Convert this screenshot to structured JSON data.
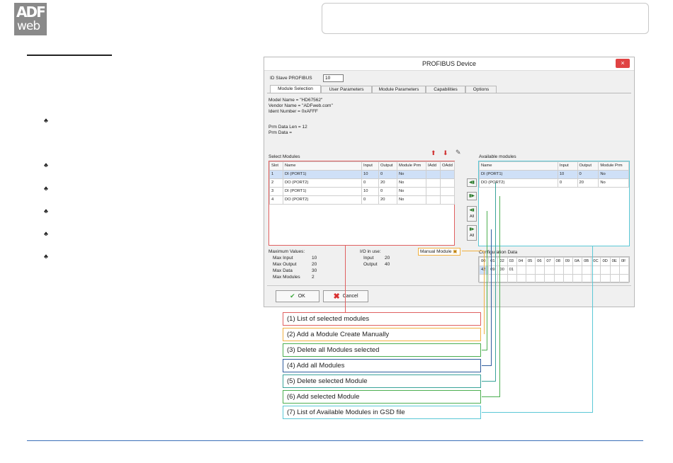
{
  "logo": {
    "line1": "ADF",
    "line2": "web"
  },
  "dialog": {
    "title": "PROFIBUS Device",
    "close": "×",
    "id_slave_label": "ID Slave PROFIBUS",
    "id_slave_value": "10",
    "tabs": [
      "Module Selection",
      "User Parameters",
      "Module Parameters",
      "Capabilities",
      "Options"
    ],
    "info": [
      "Model Name = \"HD67562\"",
      "Vendor Name = \"ADFweb.com\"",
      "Ident Number = 0xAFFF",
      "",
      "Prm Data Len = 12",
      "Prm Data ="
    ],
    "select_label": "Select Modules",
    "available_label": "Available modules",
    "selected_table": {
      "headers": [
        "Slot",
        "Name",
        "Input",
        "Output",
        "Module Prm",
        "IAdd",
        "OAdd"
      ],
      "rows": [
        [
          "1",
          "DI (PORT1)",
          "10",
          "0",
          "No",
          "",
          ""
        ],
        [
          "2",
          "DO (PORT2)",
          "0",
          "20",
          "No",
          "",
          ""
        ],
        [
          "3",
          "DI (PORT1)",
          "10",
          "0",
          "No",
          "",
          ""
        ],
        [
          "4",
          "DO (PORT2)",
          "0",
          "20",
          "No",
          "",
          ""
        ]
      ]
    },
    "available_table": {
      "headers": [
        "Name",
        "Input",
        "Output",
        "Module Prm"
      ],
      "rows": [
        [
          "DI (PORT1)",
          "10",
          "0",
          "No"
        ],
        [
          "DO (PORT2)",
          "0",
          "20",
          "No"
        ]
      ]
    },
    "all_label": "All",
    "manual_module": "Manual Module",
    "config_label": "Configuration Data",
    "config_rows": [
      [
        "00",
        "01",
        "02",
        "03",
        "04",
        "05",
        "06",
        "07",
        "08",
        "09",
        "0A",
        "0B",
        "0C",
        "0D",
        "0E",
        "0F"
      ],
      [
        "42",
        "09",
        "00",
        "01",
        "",
        "",
        "",
        "",
        "",
        "",
        "",
        "",
        "",
        "",
        "",
        ""
      ],
      [
        "",
        "",
        "",
        "",
        "",
        "",
        "",
        "",
        "",
        "",
        "",
        "",
        "",
        "",
        "",
        ""
      ]
    ],
    "max_title": "Maximum Values:",
    "max": [
      [
        "Max Input",
        "10"
      ],
      [
        "Max Output",
        "20"
      ],
      [
        "Max Data",
        "30"
      ],
      [
        "Max Modules",
        "2"
      ]
    ],
    "io_title": "I/O in use:",
    "io": [
      [
        "Input",
        "20"
      ],
      [
        "Output",
        "40"
      ]
    ],
    "ok": "OK",
    "cancel": "Cancel"
  },
  "legend": [
    "(1) List of selected modules",
    "(2) Add a Module Create Manually",
    "(3) Delete all Modules selected",
    "(4) Add all Modules",
    "(5) Delete selected Module",
    "(6) Add selected Module",
    "(7) List of Available Modules in GSD file"
  ],
  "colors": {
    "red": "#e06060",
    "orange": "#f0b040",
    "green": "#4caf50",
    "blue": "#2f5d9e",
    "teal": "#3aa39a",
    "cyan": "#5bc8d6",
    "footer_line": "#3b6fb8"
  }
}
